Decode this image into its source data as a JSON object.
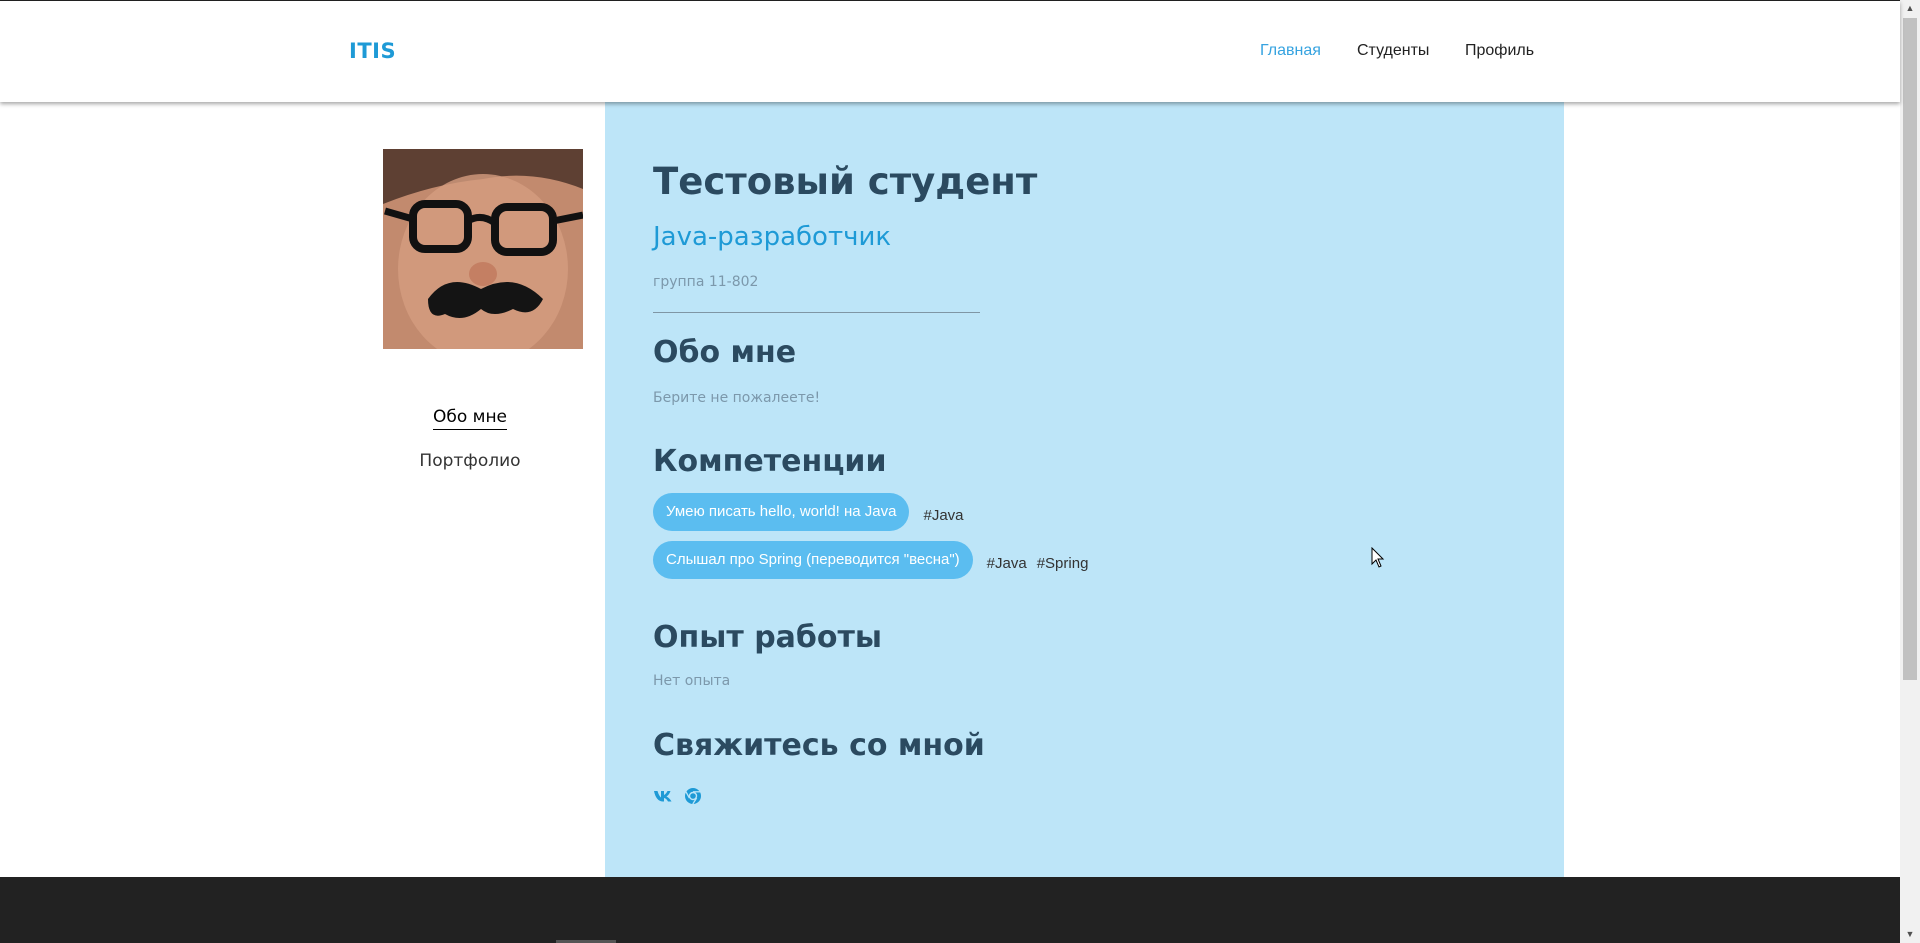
{
  "header": {
    "logo": "ITIS",
    "nav": [
      {
        "label": "Главная"
      },
      {
        "label": "Студенты"
      },
      {
        "label": "Профиль"
      }
    ]
  },
  "sidebar": {
    "links": [
      {
        "label": "Обо мне"
      },
      {
        "label": "Портфолио"
      }
    ]
  },
  "profile": {
    "name": "Тестовый студент",
    "role": "Java-разработчик",
    "group": "группа 11-802",
    "about_heading": "Обо мне",
    "about_text": "Берите не пожалеете!",
    "skills_heading": "Компетенции",
    "skills": [
      {
        "label": "Умею писать hello, world! на Java",
        "tags": [
          "#Java"
        ]
      },
      {
        "label": "Слышал про Spring (переводится \"весна\")",
        "tags": [
          "#Java",
          "#Spring"
        ]
      }
    ],
    "experience_heading": "Опыт работы",
    "experience_text": "Нет опыта",
    "contact_heading": "Свяжитесь со мной",
    "contacts": [
      {
        "icon": "vk-icon"
      },
      {
        "icon": "chrome-icon"
      }
    ]
  },
  "colors": {
    "accent": "#1e9ad6",
    "content_bg": "#bde5f8",
    "skill_pill": "#5bbdf0",
    "footer_bg": "#222222"
  }
}
